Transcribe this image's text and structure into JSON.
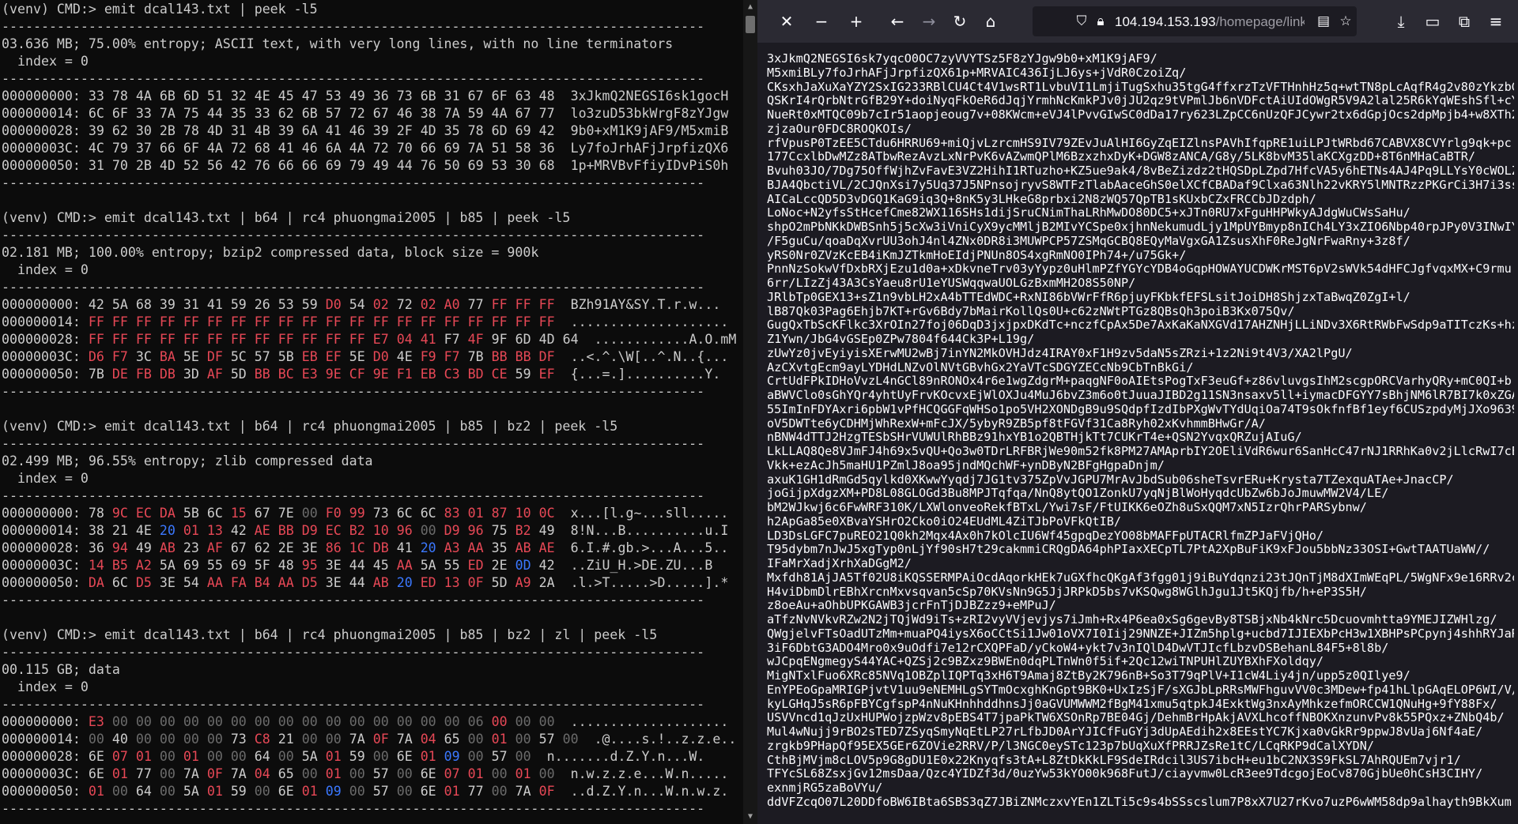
{
  "terminal": {
    "prompt": "(venv) CMD:>",
    "commands": [
      "emit dcal143.txt | peek -l5",
      "emit dcal143.txt | b64 | rc4 phuongmai2005 | b85 | peek -l5",
      "emit dcal143.txt | b64 | rc4 phuongmai2005 | b85 | bz2 | peek -l5",
      "emit dcal143.txt | b64 | rc4 phuongmai2005 | b85 | bz2 | zl | peek -l5"
    ],
    "infos": [
      "03.636 MB; 75.00% entropy; ASCII text, with very long lines, with no line terminators",
      "02.181 MB; 100.00% entropy; bzip2 compressed data, block size = 900k",
      "02.499 MB; 96.55% entropy; zlib compressed data",
      "00.115 GB; data"
    ],
    "index_label": "  index = 0",
    "blocks": [
      {
        "offsets": [
          "000000000:",
          "000000014:",
          "000000028:",
          "00000003C:",
          "000000050:"
        ],
        "rows": [
          "33 78 4A 6B 6D 51 32 4E 45 47 53 49 36 73 6B 31 67 6F 63 48",
          "6C 6F 33 7A 75 44 35 33 62 6B 57 72 67 46 38 7A 59 4A 67 77",
          "39 62 30 2B 78 4D 31 4B 39 6A 41 46 39 2F 4D 35 78 6D 69 42",
          "4C 79 37 66 6F 4A 72 68 41 46 6A 4A 72 70 66 69 7A 51 58 36",
          "31 70 2B 4D 52 56 42 76 66 66 69 79 49 44 76 50 69 53 30 68"
        ],
        "colors": [
          "wwwwwwwwwwwwwwwwwwww",
          "wwwwwwwwwwwwwwwwwwww",
          "wwwwwwwwwwwwwwwwwwww",
          "wwwwwwwwwwwwwwwwwwww",
          "wwwwwwwwwwwwwwwwwwww"
        ],
        "ascii": [
          "3xJkmQ2NEGSI6sk1gocH",
          "lo3zuD53bkWrgF8zYJgw",
          "9b0+xM1K9jAF9/M5xmiB",
          "Ly7foJrhAFjJrpfizQX6",
          "1p+MRVBvFfiyIDvPiS0h"
        ]
      },
      {
        "offsets": [
          "000000000:",
          "000000014:",
          "000000028:",
          "00000003C:",
          "000000050:"
        ],
        "rows": [
          "42 5A 68 39 31 41 59 26 53 59 D0 54 02 72 02 A0 77 FF FF FF",
          "FF FF FF FF FF FF FF FF FF FF FF FF FF FF FF FF FF FF FF FF",
          "FF FF FF FF FF FF FF FF FF FF FF FF E7 04 41 F7 4F 9F 6D 4D 64",
          "D6 F7 3C BA 5E DF 5C 57 5B EB EF 5E D0 4E F9 F7 7B BB BB DF",
          "7B DE FB DB 3D AF 5D BB BC E3 9E CF 9E F1 EB C3 BD CE 59 EF"
        ],
        "colors": [
          "wwwwwwwwwwrwrwrrwrrr",
          "rrrrrrrrrrrrrrrrrrrr",
          "rrrrrrrrrrrrrrrwrwww",
          "rrwrwrwwwrrwrwrrwrrr",
          "wrrrwrwrrrrrrrrrrrwr"
        ],
        "ascii": [
          "BZh91AY&SY.T.r.w...",
          "....................",
          "............A.O.mMd",
          "..<.^.\\W[..^.N..{...",
          "{...=.]..........Y."
        ]
      },
      {
        "offsets": [
          "000000000:",
          "000000014:",
          "000000028:",
          "00000003C:",
          "000000050:"
        ],
        "rows": [
          "78 9C EC DA 5B 6C 15 67 7E 00 F0 99 73 6C 6C 83 01 87 10 0C",
          "38 21 4E 20 01 13 42 AE BB D9 EC B2 10 96 00 D9 96 75 B2 49",
          "36 94 49 AB 23 AF 67 62 2E 3E 86 1C DB 41 20 A3 AA 35 AB AE",
          "14 B5 A2 5A 69 55 69 5F 48 95 3E 44 45 AA 5A 55 ED 2E 0D 42",
          "DA 6C D5 3E 54 AA FA B4 AA D5 3E 44 AB 20 ED 13 0F 5D A9 2A"
        ],
        "colors": [
          "wrrrwwrwwgrrwwwrrrrr",
          "wwwbrrwrrrrrrrgrrwrw",
          "wrwrwrwwwwrrrwbrrwrr",
          "rrrwwwwwwrwwwrwwrwbw",
          "rwrwwrrrrrwwrbrrrwrw"
        ],
        "ascii": [
          "x...[l.g~...sll.....",
          "8!N...B..........u.I",
          "6.I.#.gb.>...A...5..",
          "..ZiU_H.>DE.ZU...B",
          ".l.>T.....>D.....].*"
        ]
      },
      {
        "offsets": [
          "000000000:",
          "000000014:",
          "000000028:",
          "00000003C:",
          "000000050:"
        ],
        "rows": [
          "E3 00 00 00 00 00 00 00 00 00 00 00 00 00 00 00 06 00 00 00",
          "00 40 00 00 00 00 73 C8 21 00 00 7A 0F 7A 04 65 00 01 00 57 00",
          "6E 07 01 00 01 00 00 64 00 5A 01 59 00 6E 01 09 00 57 00",
          "6E 01 77 00 7A 0F 7A 04 65 00 01 00 57 00 6E 07 01 00 01 00",
          "01 00 64 00 5A 01 59 00 6E 01 09 00 57 00 6E 01 77 00 7A 0F"
        ],
        "colors": [
          "rggggggggggggggggrggg",
          "gwggggwrwggwrwrwgrgwg",
          "wrrgrggwgwrwgwrbgwg",
          "wrwgwrwrwgrgwgwrrgrg",
          "rgwgwrwgwrbgwgwrwgwr"
        ],
        "ascii": [
          "....................",
          ".@....s.!..z.z.e...W.",
          "n.......d.Z.Y.n...W.",
          "n.w.z.z.e...W.n.....",
          "..d.Z.Y.n...W.n.w.z."
        ]
      }
    ]
  },
  "browser": {
    "url_host": "104.194.153.193",
    "url_path": "/homepage/links/dcal",
    "lines": [
      "3xJkmQ2NEGSI6sk7yqcO0OC7zyVVYTSz5F8zYJgw9b0+xM1K9jAF9/",
      "M5xmiBLy7foJrhAFjJrpfizQX61p+MRVAIC436IjLJ6ys+jVdR0CzoiZq/",
      "CKsxhJaXuXaYZY2SxIG233RBlCU4Ct4V1wsRT1LvbuVI1LmjiTugSxhu35tgG4ffxrzTzVFTHnhHz5q+wtTN8pLcAqfR4g2v80zYkzbG",
      "QSKrI4rQrbNtrGfB29Y+doiNyqFkOeR6dJqjYrmhNcKmkPJv0jJU2qz9tVPmlJb6nVDFctAiUIdOWgR5V9A2lal25R6kYqWEshSfl+cY",
      "NueRt0xMTQC09b7cIr51aopjeoug7v+08KWcm+eVJ4lPvvGIwSC0dDa17ry623LZpCC6nUzQFJCywr2tx6dGpjOcs2dpMpjb4+w8XTh2",
      "zjzaOur0FDC8ROQKOIs/",
      "rfVpusP0TzEE5CTdu6HRRU69+miQjvLzrcmHS9IV79ZEvJuAlHI6GyZqEIZlnsPAVhIfqpRE1uiLPJtWRbd67CABVX8CVYrlg9qk+pc",
      "177CcxlbDwMZz8ATbwRezAvzLxNrPvK6vAZwmQPlM6BzxzhxDyK+DGW8zANCA/G8y/5LK8bvM35laKCXgzDD+8T6nMHaCaBTR/",
      "Bvuh03JO/7Dg75OffWjhZvFavE3VZ2HihI1RTuzho+KZ5ue9ak4/8vBeZizdz2tHQSDpLZpd7HfcVA5y6hETNs4AJ4Pq9LLYsY0cWOLZ",
      "BJA4QbctiVL/2CJQnXsi7y5Uq37J5NPnsojryvS8WTFzTlabAaceGhS0elXCfCBADaf9Clxa63Nlh22vKRY5lMNTRzzPKGrCi3H7i3ss",
      "AICaLccQD5D3vDGQ1KaG9iq3Q+8nK5y3LHkeG8prbxi2N8zWQ57QpTB1sKUxbCZxFRCCbJDzdph/",
      "LoNoc+N2yfsStHcefCme82WX116SHs1dijSruCNimThaLRhMwDO80DC5+xJTn0RU7xFguHHPWkyAJdgWuCWsSaHu/",
      "shpO2mPbNKkDWBSnh5j5cXw3iVniCyX9ycMMljB2MIvYCSpe0xjhnNekumudLjy1MpUYBmyp8nICh4LY3xZIO6Nbp40rpJPy0V3INwIY",
      "/F5guCu/qoaDqXvrUU3ohJ4nl4ZNx0DR8i3MUWPCP57ZSMqGCBQ8EQyMaVgxGA1ZsusXhF0ReJgNrFwaRny+3z8f/",
      "yRS0Nr0ZVzKcEB4iKmJZTkmHoEIdjPNUn8OS4xgRmNO0IPh74+/u75Gk+/",
      "PnnNzSokwVfDxbRXjEzu1d0a+xDkvneTrv03yYypz0uHlmPZfYGYcYDB4oGqpHOWAYUCDWKrMST6pV2sWVk54dHFCJgfvqxMX+C9rmu",
      "6rr/LIzZj43A3CsYaeu8rU1eYUSWqqwaUOLGzBxmMH2O8S50NP/",
      "JRlbTp0GEX13+sZ1n9vbLH2xA4bTTEdWDC+RxNI86bVWrFfR6pjuyFKbkfEFSLsitJoiDH8ShjzxTaBwqZ0ZgI+l/",
      "lB87Qk03Pag6Ehjb7KT+rGv6Bdy7bMairKollQs0U+c62zNWtPTGz8QBsQh3poiB3Kx075Qv/",
      "GugQxTbScKFlkc3XrOIn27foj06DqD3jxjpxDKdTc+nczfCpAx5De7AxKaKaNXGVd17AHZNHjLLiNDv3X6RtRWbFwSdp9aTITczKs+hz",
      "Z1Ywn/JbG4vGSEp0ZPw7804f644Ck3P+L19g/",
      "zUwYz0jvEyiyisXErwMU2wBj7inYN2MkOVHJdz4IRAY0xF1H9zv5daN5sZRzi+1z2Ni9t4V3/XA2lPgU/",
      "AzCXvtgEcm9ayLYDHdLNZvOlNVtGBvhGx2YaVTcSDGYZECcNb9CbTnBkGi/",
      "CrtUdFPkIDHoVvzL4nGCl89nRONOx4r6e1wgZdgrM+paqgNF0oAIEtsPogTxF3euGf+z86vluvgsIhM2scgpORCVarhyQRy+mC0QI+b",
      "aBWVClo0sGhYQr4yhtUyFrvKOcvxEjWlOXJu4MuJ6bvZ3m6o0tJuuaJIBD2g11SN3nsaxv5ll+iymacDFGYY7sBhjNM6lR7BI7k0xZGA",
      "55ImInFDYAxri6pbW1vPfHCQGGFqWHSo1po5VH2XONDgB9u9SQdpfIzdIbPXgWvTYdUqiOa74T9sOkfnfBf1eyf6CUSzpdyMjJXo9639",
      "oV5DWTte6yCDHMjWhRexW+mFcJX/5ybyR9ZB5pf8tFGVf31Ca8Ryh02xKvhmmBHwGr/A/",
      "nBNW4dTTJ2HzgTESbSHrVUWUlRhBBz91hxYB1o2QBTHjkTt7CUKrT4e+QSN2YvqxQRZujAIuG/",
      "LkLLAQ8Qe8VJmFJ4h69x5vQU+Qo3w0TDrLRFBRjWe90m52fk8PM27AMAprbIY2OEliVdR6wur6SanHcC47rNJ1RRhKa0v2jLlcRwI7cE",
      "Vkk+ezAcJh5maHU1PZmlJ8oa95jndMQchWF+ynDByN2BFgHgpaDnjm/",
      "axuK1GH1dRmGd5qylkd0XKwwYyqdj7JG1tv375ZpVvJGPU7MrAvJbdSub06sheTsvrERu+Krysta7TZexquATAe+JnacCP/",
      "joGijpXdgzXM+PD8L08GLOGd3Bu8MPJTqfqa/NnQ8ytQO1ZonkU7yqNjBlWoHyqdcUbZw6bJoJmuwMW2V4/LE/",
      "bM2WJkwj6c6FwWRF310K/LXWlonveoRekfBTxL/Ywi7sF/FtUIKK6eOZh8uSxQQM7xN5IzrQhrPARSybnw/",
      "h2ApGa85e0XBvaYSHrO2Cko0iO24EUdML4ZiTJbPoVFkQtIB/",
      "LD3DsLGFC7puREO21Q0kh2Mqx4Ax0h7kOlcIU6Wf45gpqDezYO08bMAFFpUTACRlfmZPJaFVjQHo/",
      "T95dybm7nJwJ5xgTyp0nLjYf90sH7t29cakmmiCRQgDA64phPIaxXECpTL7PtA2XpBuFiK9xFJou5bbNz33OSI+GwtTAATUaWW//",
      "IFaMrXadjXrhXaDGgM2/",
      "Mxfdh81AjJA5Tf02U8iKQSSERMPAiOcdAqorkHEk7uGXfhcQKgAf3fgg01j9iBuYdqnzi23tJQnTjM8dXImWEqPL/5WgNFx9e16RRv2c",
      "H4viDbmDlrEBhXrcnMxvsqvan5cSp70KVsNn9G5JjJRPkD5bs7vKSQwg8WGlhJgu1Jt5KQjfb/h+eP3S5H/",
      "z8oeAu+aOhbUPKGAWB3jcrFnTjDJBZzz9+eMPuJ/",
      "aTfzNvNVkvRZw2N2jTQjWd9iTs+zRI2vyVVjevjys7iJmh+Rx4P6ea0xSg6gevBy8TSBjxNb4kNrc5Dcuovmhtta9YMEJIZWHlzg/",
      "QWgjelvFTsOadUTzMm+muaPQ4iysX6oCCtSi1Jw01oVX7I0Iij29NNZE+JIZm5hplg+ucbd7IJIEXbPcH3w1XBHPsPCpynj4shhRYJaR",
      "3iF6DbtG3ADO4Mro0x9uOdfi7e12rCXQPFaD/yCkoW4+ykt7v3nIQlD4DwVTJIcfLbzvDSBehanL84F5+8l8b/",
      "wJCpqENgmegyS44YAC+QZSj2c9BZxz9BWEn0dqPLTnWn0f5if+2Qc12wiTNPUHlZUYBXhFXoldqy/",
      "MigNTxlFuo6XRc85NVq1OBZplIQPTq3xH6T9Amaj8ZtBy2K796nB+So3T79qPlV+I1cW4Liy4jn/upp5z0QIlye9/",
      "EnYPEoGpaMRIGPjvtV1uu9eNEMHLgSYTmOcxghKnGpt9BK0+UxIzSjF/sXGJbLpRRsMWFhguvVV0c3MDew+fp41hLlpGAqELOP6WI/V/",
      "kyLGHqJ5sR6pFBYCgfspP4nNuKHnhhddhnsJj0aGVUMWWM2fBgM41xmu5qtpkJ4ExktWg3nxAyMhkzefmORCCW1QNuHg+9fY88Fx/",
      "USVVncd1qJzUxHUPWojzpWzv8pEBS4T7jpaPkTW6XSOnRp7BE04Gj/DehmBrHpAkjAVXLhcoffNBOKXnzunvPv8k55PQxz+ZNbQ4b/",
      "Mul4wNujj9rBO2sTED7ZSyqSmyNqEtLP27rLfbJD0ArYJICfFuGYj3dUpAEdih2x8EEstYC7Kjxa0vGkRr9ppwJ8vUaj6Nf4aE/",
      "zrgkb9PHapQf95EX5GEr6ZOVie2RRV/P/l3NGC0eySTc123p7bUqXuXfPRRJZsRe1tC/LCqRKP9dCalXYDN/",
      "CthBjMVjm8cLOV5p9G8gDU1E0x22Knyqfs3tA+L8ZtDkKkLF9SdeIRdcil3US7ibcH+eu1bC2NX3S9FkSL7AhRQUEm7vjr1/",
      "TFYcSL68ZsxjGv12msDaa/Qzc4YIDZf3d/0uzYw53kYO00k968FutJ/ciayvmw0LcR3ee9TdcgojEoCv870GjbUe0hCsH3CIHY/",
      "exnmjRG5zaBoVYu/",
      "ddVFZcqO07L20DDfoBW6IBta6SBS3qZ7JBiZNMczxvYEn1ZLTi5c9s4bSSscslum7P8xX7U27rKvo7uzP6wWM58dp9alhayth9BkXum"
    ]
  }
}
